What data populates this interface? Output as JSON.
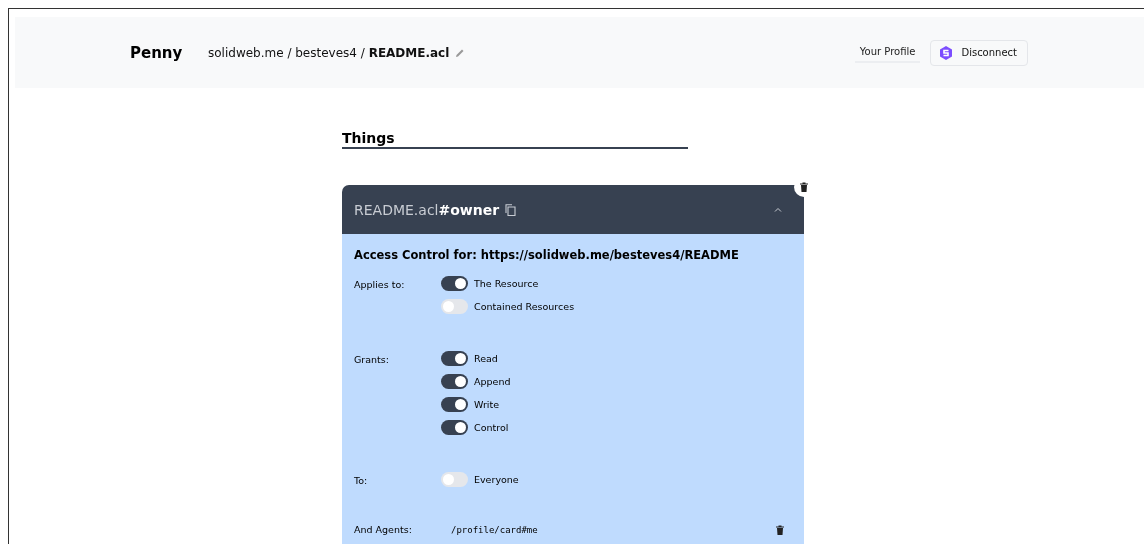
{
  "header": {
    "brand": "Penny",
    "breadcrumb": "solidweb.me / besteves4 / **README.acl**",
    "profile_link": "Your Profile",
    "disconnect_button": "Disconnect"
  },
  "section_title": "Things",
  "card": {
    "title": "README.acl**#owner**",
    "expanded": true,
    "heading": "Access Control for: https://solidweb.me/besteves4/README",
    "groups": [
      {
        "label": "Applies to:",
        "toggles": [
          {
            "label": "The Resource",
            "on": true
          },
          {
            "label": "Contained Resources",
            "on": false
          }
        ]
      },
      {
        "label": "Grants:",
        "toggles": [
          {
            "label": "Read",
            "on": true
          },
          {
            "label": "Append",
            "on": true
          },
          {
            "label": "Write",
            "on": true
          },
          {
            "label": "Control",
            "on": true
          }
        ]
      },
      {
        "label": "To:",
        "toggles": [
          {
            "label": "Everyone",
            "on": false
          }
        ]
      }
    ],
    "agents": {
      "label": "And Agents:",
      "value": "/profile/card#me"
    }
  }
}
